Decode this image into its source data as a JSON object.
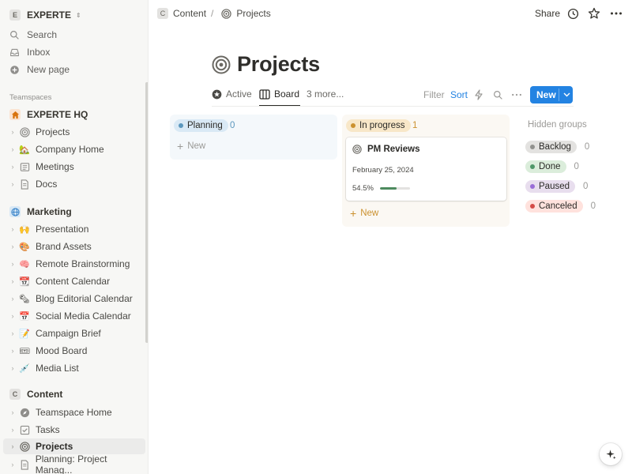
{
  "workspace": {
    "badge": "E",
    "name": "EXPERTE"
  },
  "sidebar": {
    "nav": [
      {
        "label": "Search",
        "icon": "search-icon"
      },
      {
        "label": "Inbox",
        "icon": "inbox-icon"
      },
      {
        "label": "New page",
        "icon": "plus-circle-icon"
      }
    ],
    "teamspaces_label": "Teamspaces",
    "groups": [
      {
        "name": "EXPERTE HQ",
        "icon": "home-icon",
        "items": [
          {
            "label": "Projects",
            "icon": "target-icon"
          },
          {
            "label": "Company Home",
            "icon": "house-icon"
          },
          {
            "label": "Meetings",
            "icon": "notes-icon"
          },
          {
            "label": "Docs",
            "icon": "doc-icon"
          }
        ]
      },
      {
        "name": "Marketing",
        "icon": "globe-icon",
        "items": [
          {
            "label": "Presentation",
            "icon": "raised-hands-icon"
          },
          {
            "label": "Brand Assets",
            "icon": "palette-icon"
          },
          {
            "label": "Remote Brainstorming",
            "icon": "brain-icon"
          },
          {
            "label": "Content Calendar",
            "icon": "calendar-icon"
          },
          {
            "label": "Blog Editorial Calendar",
            "icon": "newspaper-icon"
          },
          {
            "label": "Social Media Calendar",
            "icon": "tear-off-calendar-icon"
          },
          {
            "label": "Campaign Brief",
            "icon": "memo-icon"
          },
          {
            "label": "Mood Board",
            "icon": "ticket-icon"
          },
          {
            "label": "Media List",
            "icon": "syringe-icon"
          }
        ]
      },
      {
        "name": "Content",
        "badge": "C",
        "items": [
          {
            "label": "Teamspace Home",
            "icon": "compass-icon"
          },
          {
            "label": "Tasks",
            "icon": "checkbox-icon"
          },
          {
            "label": "Projects",
            "icon": "target-icon",
            "selected": true
          },
          {
            "label": "Planning: Project Manag...",
            "icon": "doc-icon"
          }
        ]
      }
    ]
  },
  "topbar": {
    "breadcrumb": [
      {
        "label": "Content",
        "badge": "C"
      },
      {
        "label": "Projects",
        "icon": "target-icon"
      }
    ],
    "separator": "/",
    "share_label": "Share"
  },
  "page": {
    "title": "Projects",
    "icon": "target-icon"
  },
  "views": {
    "tabs": [
      {
        "label": "Active",
        "icon": "star-icon"
      },
      {
        "label": "Board",
        "icon": "board-icon",
        "active": true
      }
    ],
    "more": "3 more...",
    "filter": "Filter",
    "sort": "Sort",
    "new_label": "New"
  },
  "board": {
    "columns": [
      {
        "status": "Planning",
        "count": "0",
        "dot_color": "#5b97bd",
        "pill_bg": "#d9e9f5",
        "count_color": "#5b97bd",
        "new_label": "New"
      },
      {
        "status": "In progress",
        "count": "1",
        "dot_color": "#cb912f",
        "pill_bg": "#f8e7c8",
        "count_color": "#cb912f",
        "new_label": "New",
        "cards": [
          {
            "title": "PM Reviews",
            "icon": "target-icon",
            "date": "February 25, 2024",
            "progress_label": "54.5%",
            "progress": 0.545
          }
        ]
      }
    ],
    "hidden_title": "Hidden groups",
    "hidden": [
      {
        "status": "Backlog",
        "count": "0",
        "dot_color": "#91918e",
        "pill_bg": "#e3e2e0"
      },
      {
        "status": "Done",
        "count": "0",
        "dot_color": "#4f9768",
        "pill_bg": "#dbeddb"
      },
      {
        "status": "Paused",
        "count": "0",
        "dot_color": "#9a6dd7",
        "pill_bg": "#e8deee"
      },
      {
        "status": "Canceled",
        "count": "0",
        "dot_color": "#d44c47",
        "pill_bg": "#ffe2dd"
      }
    ]
  },
  "colors": {
    "accent": "#2383e2",
    "progress": "#4d8a5e"
  }
}
